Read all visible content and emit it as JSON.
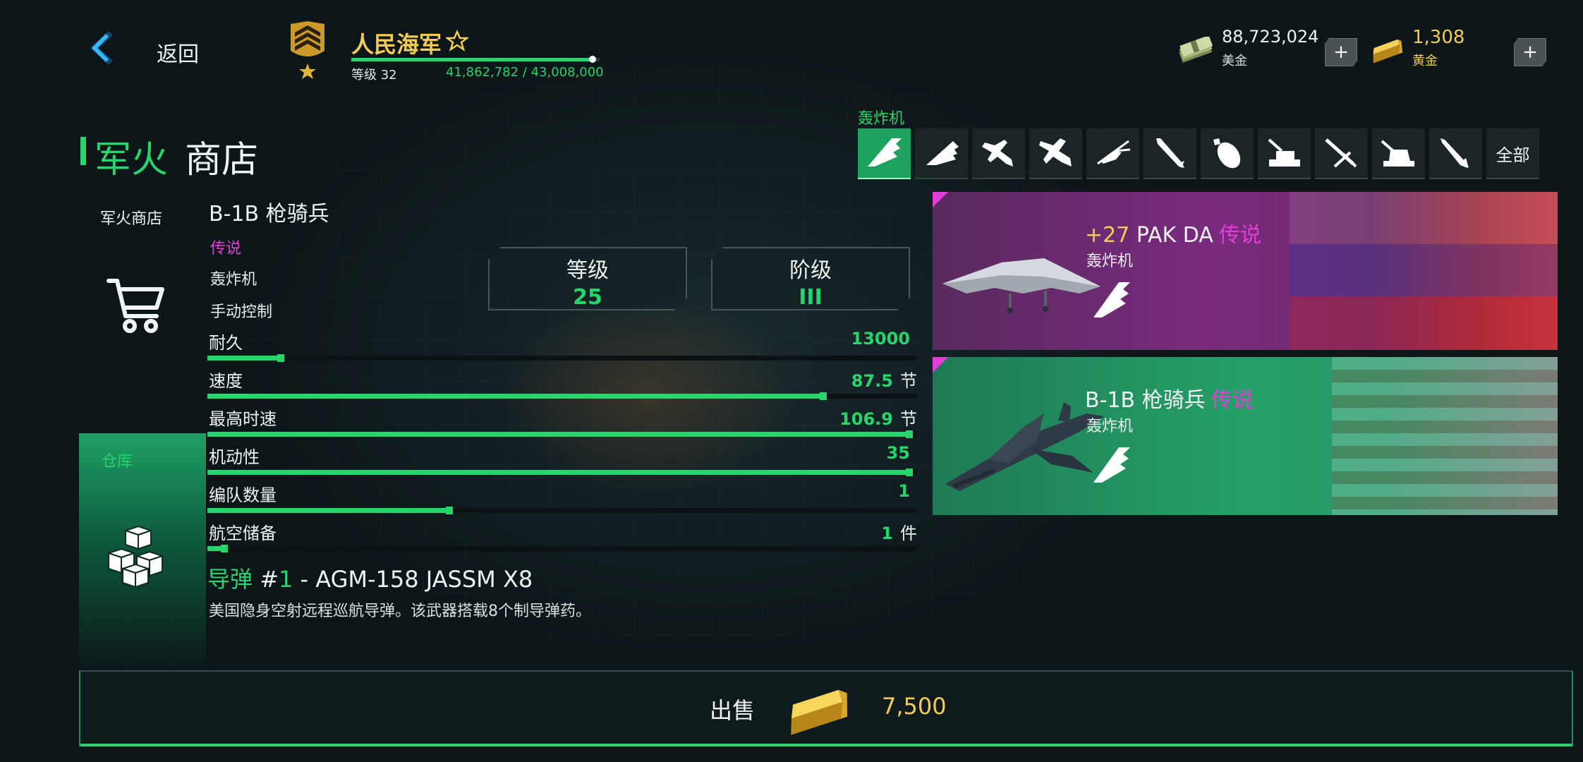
{
  "header": {
    "back_label": "返回",
    "player_name": "人民海军",
    "level_text": "等级 32",
    "xp_text": "41,862,782 / 43,008,000",
    "xp_progress": 0.973,
    "cash_value": "88,723,024",
    "cash_label": "美金",
    "gold_value": "1,308",
    "gold_label": "黄金",
    "plus_label": "+"
  },
  "title": {
    "green": "军火",
    "white": "商店"
  },
  "nav": {
    "shop_label": "军火商店",
    "warehouse_label": "仓库"
  },
  "unit": {
    "name": "B-1B 枪骑兵",
    "rarity": "传说",
    "type": "轰炸机",
    "control": "手动控制",
    "level_badge": {
      "label": "等级",
      "value": "25"
    },
    "tier_badge": {
      "label": "阶级",
      "value": "III"
    },
    "stats": [
      {
        "label": "耐久",
        "value": "13000",
        "unit": "",
        "fill": 0.104
      },
      {
        "label": "速度",
        "value": "87.5",
        "unit": "节",
        "fill": 0.869
      },
      {
        "label": "最高时速",
        "value": "106.9",
        "unit": "节",
        "fill": 0.99
      },
      {
        "label": "机动性",
        "value": "35",
        "unit": "",
        "fill": 0.99
      },
      {
        "label": "编队数量",
        "value": "1",
        "unit": "",
        "fill": 0.342
      },
      {
        "label": "航空储备",
        "value": "1",
        "unit": "件",
        "fill": 0.025
      }
    ],
    "missile": {
      "prefix": "导弹",
      "hash": " #",
      "num": "1",
      "rest": " - AGM-158 JASSM X8",
      "desc": "美国隐身空射远程巡航导弹。该武器搭载8个制导弹药。"
    }
  },
  "categories": {
    "label": "轰炸机",
    "all_label": "全部",
    "icons": [
      "stealth-bomber-icon",
      "flying-wing-icon",
      "fighter-jet-icon",
      "fighter-jet-icon",
      "helicopter-icon",
      "missile-icon",
      "bomb-icon",
      "anti-air-turret-icon",
      "artillery-icon",
      "naval-gun-icon",
      "rocket-icon"
    ]
  },
  "cards": [
    {
      "plus": "+27",
      "name": "PAK DA",
      "rarity": "传说",
      "type": "轰炸机"
    },
    {
      "plus": "",
      "name": "B-1B 枪骑兵",
      "rarity": "传说",
      "type": "轰炸机"
    }
  ],
  "sell": {
    "label": "出售",
    "price": "7,500"
  },
  "colors": {
    "accent_green": "#28d46c",
    "legend_magenta": "#e23fd8",
    "gold": "#f3cc55"
  }
}
